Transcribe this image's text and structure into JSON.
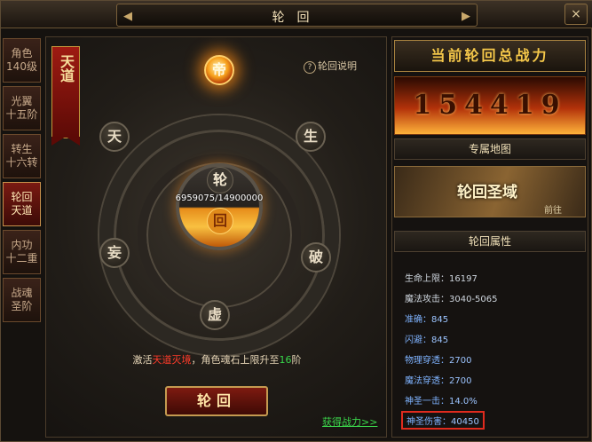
{
  "window": {
    "title": "轮回",
    "close_symbol": "×",
    "nav_left": "◀",
    "nav_right": "▶"
  },
  "left_tabs": [
    {
      "line1": "角色",
      "line2": "140级"
    },
    {
      "line1": "光翼",
      "line2": "十五阶"
    },
    {
      "line1": "转生",
      "line2": "十六转"
    },
    {
      "line1": "轮回",
      "line2": "天道"
    },
    {
      "line1": "内功",
      "line2": "十二重"
    },
    {
      "line1": "战魂",
      "line2": "圣阶"
    }
  ],
  "active_tab_index": 3,
  "main": {
    "banner": "天道",
    "help_link": "轮回说明",
    "nodes": {
      "top": "帝",
      "upper_left": "天",
      "upper_right": "生",
      "lower_left": "妄",
      "lower_right": "破",
      "bottom": "虚"
    },
    "orb_upper": "轮",
    "orb_lower": "回",
    "soul_value": "6959075/14900000",
    "activate_prefix": "激活",
    "activate_realm": "天道灭境",
    "activate_mid": "，角色魂石上限升至",
    "activate_level": "16",
    "activate_suffix": "阶",
    "reincarnate_button": "轮回",
    "get_power_link": "获得战力>>"
  },
  "right": {
    "power_title": "当前轮回总战力",
    "power_value": "154419",
    "exclusive_map_header": "专属地图",
    "map_name": "轮回圣域",
    "map_go": "前往",
    "attributes_header": "轮回属性",
    "stats": [
      {
        "label": "生命上限：",
        "value": "16197",
        "style": "white"
      },
      {
        "label": "魔法攻击：",
        "value": "3040-5065",
        "style": "white"
      },
      {
        "label": "准确：",
        "value": "845",
        "style": "blue"
      },
      {
        "label": "闪避：",
        "value": "845",
        "style": "blue"
      },
      {
        "label": "物理穿透：",
        "value": "2700",
        "style": "blue"
      },
      {
        "label": "魔法穿透：",
        "value": "2700",
        "style": "blue"
      },
      {
        "label": "神圣一击：",
        "value": "14.0%",
        "style": "blue"
      },
      {
        "label": "神圣伤害：",
        "value": "40450",
        "style": "blue-highlight"
      }
    ]
  },
  "colors": {
    "accent_red": "#e02b1e",
    "gold": "#f5c84a",
    "green_link": "#3bd64b",
    "stat_blue": "#7fb3ff"
  }
}
